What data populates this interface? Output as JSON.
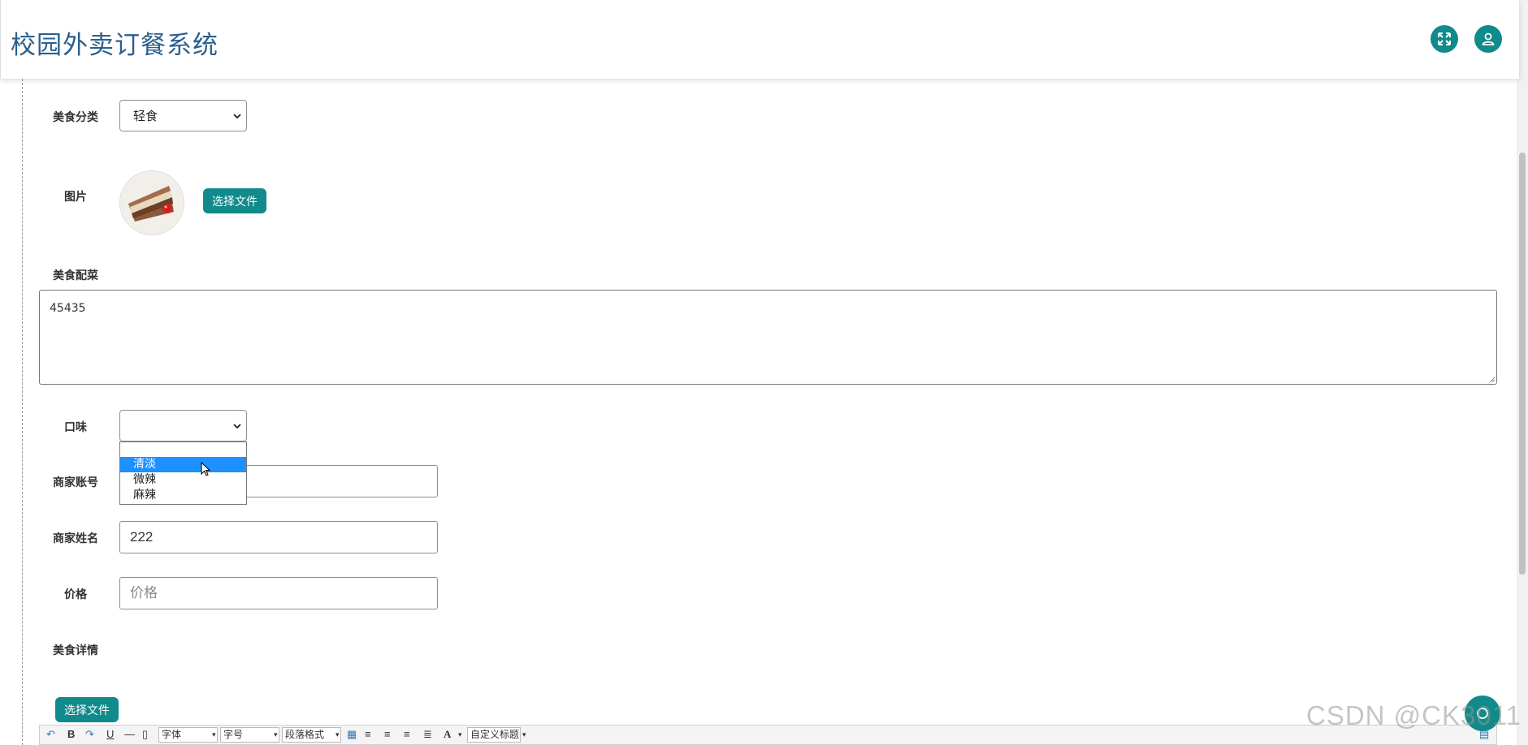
{
  "header": {
    "title": "校园外卖订餐系统",
    "icons": [
      "fullscreen-icon",
      "user-icon"
    ]
  },
  "form": {
    "category": {
      "label": "美食分类",
      "value": "轻食"
    },
    "image": {
      "label": "图片",
      "upload_button": "选择文件"
    },
    "side_dish": {
      "label": "美食配菜",
      "value": "45435"
    },
    "taste": {
      "label": "口味",
      "value": "",
      "options": [
        "清淡",
        "微辣",
        "麻辣"
      ],
      "highlighted": "清淡"
    },
    "merchant_account": {
      "label": "商家账号",
      "value": ""
    },
    "merchant_name": {
      "label": "商家姓名",
      "value": "222"
    },
    "price": {
      "label": "价格",
      "placeholder": "价格",
      "value": ""
    },
    "details": {
      "label": "美食详情",
      "upload_button": "选择文件"
    }
  },
  "editor_toolbar": {
    "font_family": "字体",
    "font_size": "字号",
    "paragraph": "段落格式",
    "custom_title": "自定义标题",
    "bold": "B",
    "underline": "U",
    "font_color": "A"
  },
  "watermark": "CSDN @CK3011",
  "colors": {
    "accent": "#108a8a",
    "brand_text": "#2b5f8e",
    "highlight": "#1e90ff"
  }
}
